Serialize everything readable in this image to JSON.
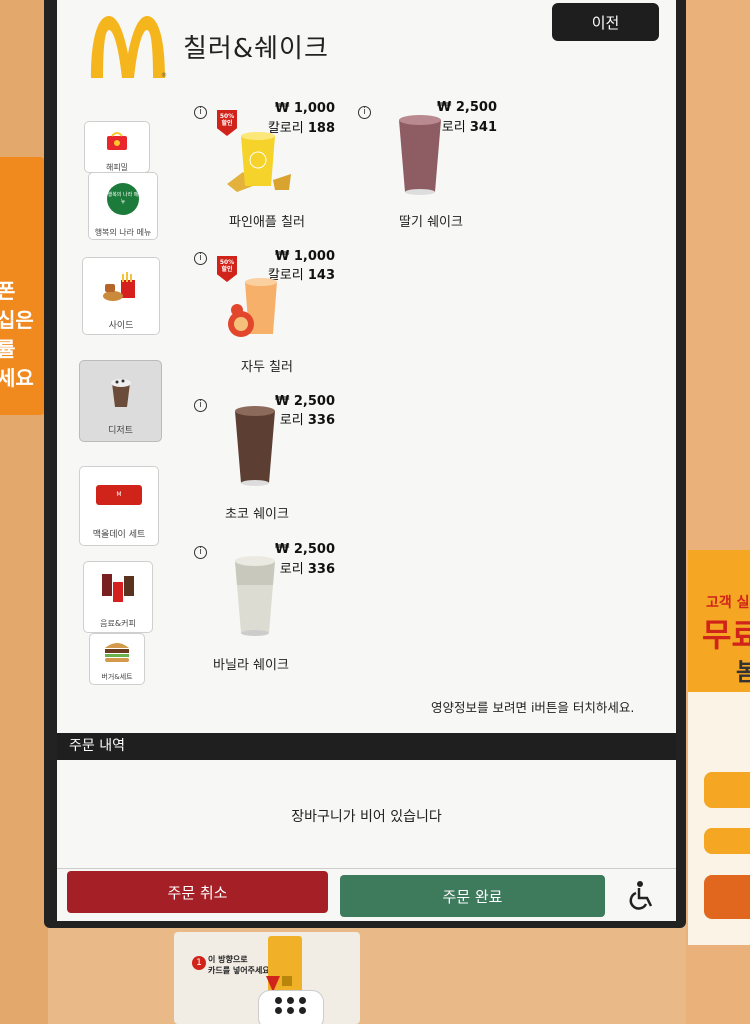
{
  "header": {
    "title": "칠러&쉐이크",
    "prev_button": "이전",
    "logo_mark": "®"
  },
  "sidebar": {
    "items": [
      {
        "label": "해피밀",
        "icon": "happy-meal-icon"
      },
      {
        "label": "행복의 나라 메뉴",
        "icon": "happy-menu-icon"
      },
      {
        "label": "사이드",
        "icon": "fries-icon"
      },
      {
        "label": "디저트",
        "icon": "dessert-icon",
        "active": true
      },
      {
        "label": "맥올데이 세트",
        "icon": "mcallday-icon"
      },
      {
        "label": "음료&커피",
        "icon": "drinks-icon"
      },
      {
        "label": "버거&세트",
        "icon": "burger-icon"
      }
    ],
    "happy_menu_badge": "행복의 나라 메뉴"
  },
  "menu": {
    "items": [
      {
        "name": "파인애플 칠러",
        "price": "₩ 1,000",
        "calorie_label": "칼로리",
        "calorie_value": "188",
        "discount_badge": "50% 할인"
      },
      {
        "name": "딸기 쉐이크",
        "price": "₩ 2,500",
        "calorie_label": "로리",
        "calorie_value": "341"
      },
      {
        "name": "자두 칠러",
        "price": "₩ 1,000",
        "calorie_label": "칼로리",
        "calorie_value": "143",
        "discount_badge": "50% 할인"
      },
      {
        "name": "초코 쉐이크",
        "price": "₩ 2,500",
        "calorie_label": "로리",
        "calorie_value": "336"
      },
      {
        "name": "바닐라 쉐이크",
        "price": "₩ 2,500",
        "calorie_label": "로리",
        "calorie_value": "336"
      }
    ],
    "info_symbol": "i",
    "hint": "영양정보를 보려면 i버튼을 터치하세요."
  },
  "order": {
    "header": "주문 내역",
    "empty_message": "장바구니가 비어 있습니다",
    "cancel_button": "주문 취소",
    "complete_button": "주문 완료"
  },
  "surroundings": {
    "left_sticker_lines": [
      "폰",
      "십은",
      "률",
      "세요"
    ],
    "right_flyer_line1": "고객 실",
    "right_flyer_line2": "무료",
    "right_flyer_line3": "봄",
    "card_step_number": "1",
    "card_instruction": "이 방향으로\n카드를 넣어주세요"
  },
  "colors": {
    "mcd_yellow": "#ffc72c",
    "cancel_red": "#a42026",
    "complete_green": "#3e7a5c",
    "header_black": "#1e1e1e"
  }
}
